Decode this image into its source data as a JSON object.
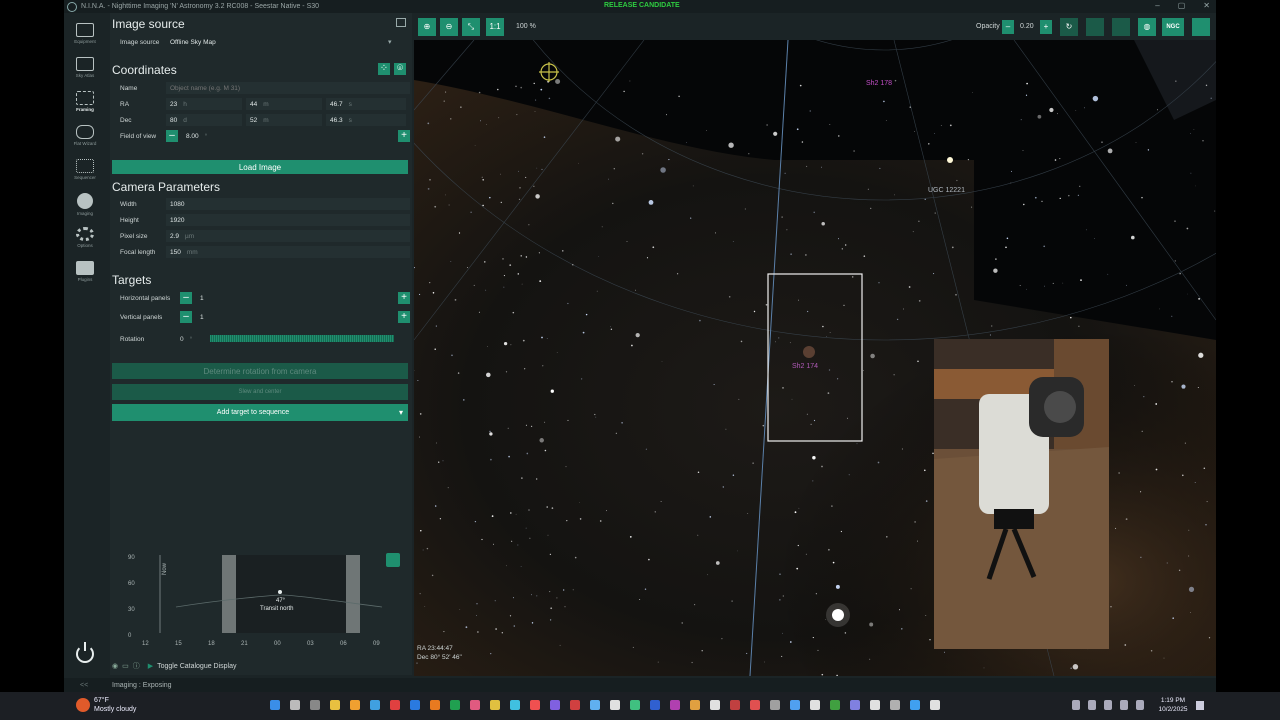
{
  "window": {
    "title": "N.I.N.A. - Nighttime Imaging 'N' Astronomy 3.2 RC008  -  Seestar Native - S30",
    "release_label": "RELEASE CANDIDATE",
    "min": "–",
    "max": "▢",
    "close": "✕"
  },
  "sidebar": {
    "items": [
      {
        "label": "Equipment"
      },
      {
        "label": "Sky Atlas"
      },
      {
        "label": "Framing"
      },
      {
        "label": "Flat Wizard"
      },
      {
        "label": "Sequencer"
      },
      {
        "label": "Imaging"
      },
      {
        "label": "Options"
      },
      {
        "label": "Plugins"
      }
    ]
  },
  "image_source": {
    "heading": "Image source",
    "label": "Image source",
    "value": "Offline Sky Map"
  },
  "coordinates": {
    "heading": "Coordinates",
    "name_label": "Name",
    "name_placeholder": "Object name (e.g. M 31)",
    "ra_label": "RA",
    "ra_h": "23",
    "ra_h_unit": "h",
    "ra_m": "44",
    "ra_m_unit": "m",
    "ra_s": "46.7",
    "ra_s_unit": "s",
    "dec_label": "Dec",
    "dec_d": "80",
    "dec_d_unit": "d",
    "dec_m": "52",
    "dec_m_unit": "m",
    "dec_s": "46.3",
    "dec_s_unit": "s",
    "fov_label": "Field of view",
    "fov_value": "8.00",
    "fov_unit": "°"
  },
  "load_image": "Load Image",
  "camera": {
    "heading": "Camera Parameters",
    "width_label": "Width",
    "width": "1080",
    "height_label": "Height",
    "height": "1920",
    "pixel_label": "Pixel size",
    "pixel": "2.9",
    "pixel_unit": "µm",
    "focal_label": "Focal length",
    "focal": "150",
    "focal_unit": "mm"
  },
  "targets": {
    "heading": "Targets",
    "hpanels_label": "Horizontal panels",
    "hpanels": "1",
    "vpanels_label": "Vertical panels",
    "vpanels": "1",
    "rotation_label": "Rotation",
    "rotation": "0",
    "rotation_unit": "°"
  },
  "buttons": {
    "determine_rotation": "Determine rotation from camera",
    "slew_center": "Slew and center",
    "add_target": "Add target to sequence"
  },
  "altitude_chart": {
    "y_ticks": [
      "90",
      "60",
      "30",
      "0"
    ],
    "x_ticks": [
      "12",
      "15",
      "18",
      "21",
      "00",
      "03",
      "06",
      "09",
      "12"
    ],
    "now_label": "Now",
    "altitude": "47°",
    "transit": "Transit north"
  },
  "catalogue": {
    "toggle": "Toggle Catalogue Display"
  },
  "toolbar": {
    "one_to_one": "1:1",
    "zoom": "100 %",
    "opacity_label": "Opacity",
    "opacity_value": "0.20",
    "ngc": "NGC"
  },
  "sky": {
    "labels": [
      {
        "text": "Sh2 178"
      },
      {
        "text": "UGC 12221"
      },
      {
        "text": "Sh2 174"
      }
    ],
    "readout_ra": "RA 23:44:47",
    "readout_dec": "Dec 80° 52' 46\""
  },
  "status": {
    "text": "Imaging :   Exposing",
    "collapse": "<<"
  },
  "taskbar": {
    "temp": "67°F",
    "weather": "Mostly cloudy",
    "time": "1:19 PM",
    "date": "10/2/2025"
  }
}
